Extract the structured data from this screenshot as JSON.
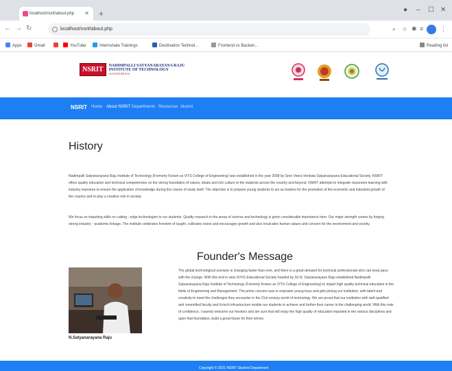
{
  "browser": {
    "tab_title": "localhost/nsrit/about.php",
    "url": "localhost/nsrit/about.php",
    "bookmarks": [
      {
        "label": "Apps",
        "color": "#4285f4"
      },
      {
        "label": "Gmail",
        "color": "#ea4335"
      },
      {
        "label": "",
        "color": "#ea4335"
      },
      {
        "label": "YouTube",
        "color": "#ff0000"
      },
      {
        "label": "Internshala Trainings",
        "color": "#1ea0e3"
      },
      {
        "label": "Destination Technol...",
        "color": "#2d5fa8"
      },
      {
        "label": "Frontend vs Backen...",
        "color": "#777777"
      }
    ],
    "reading_list": "Reading list"
  },
  "header": {
    "logo_badge": "NSRIT",
    "logo_line1": "NADIMPALLI SATYANARAYANA RAJU",
    "logo_line2": "INSTITUTE OF TECHNOLOGY",
    "logo_line3": "(AUTONOMOUS)",
    "emblems": [
      {
        "caption": "AICTE",
        "color": "#d0305a"
      },
      {
        "caption": "JNTUK",
        "color": "#e0a020"
      },
      {
        "caption": "NAAC",
        "color": "#4a9a3a"
      },
      {
        "caption": "ISO",
        "color": "#2a6fb0"
      }
    ]
  },
  "nav": {
    "brand": "NSRIT",
    "links": [
      "Home",
      "About NSRIT",
      "Departments",
      "Resources",
      "Alumni"
    ],
    "active_index": 1
  },
  "history": {
    "title": "History",
    "paragraph1": "Nadimpalli Satyanarayana Raju Institute of Technology (Formerly Known as VITS College of Engineering) was established in the year 2008 by Sree Veera Venkata Satyanarayana Educational Society. NSRIT offers quality education and technical competencies on the strong foundation of values, ideals and rich culture to the students across the country and beyond. NSRIT attempts to integrate classroom learning with industry exposure to ensure the application of knowledge during the course of study itself. The objective is to prepare young students to act as leaders for the promotion of the economic and industrial growth of the country and to play a creative role in society.",
    "paragraph2": "We focus on imparting skills on cutting - edge technologies to our students. Quality research in the areas of science and technology is given considerable importance here. Our major strength comes by forging strong industry - academic linkage. The institute celebrates freedom of taught, cultivates vision and encourages growth and also inculcates human values and concern for the environment and society."
  },
  "founder": {
    "title": "Founder's Message",
    "name": "N.Satyanarayana Raju",
    "message": "The global technological scenario is changing faster than ever, and there is a great demand for technical professionals who can keep pace with the change. With this end in view SVVS Educational Society headed by Sri N. Satyanarayana Raju established Nadimpalli Satyanarayana Raju Institute of Technology (Formerly Known as VITS College of Engineering) to impart high quality technical education in the fields of Engineering and Management. The prime concern was to empower young boys and girls joining our institution, with talent and creativity to meet the challenges they encounter in the 21st century world of technology. We are proud that our institution with well-qualified and committed faculty and hi-tech infrastructure enable our students to achieve and further their career in the challenging world. With this note of confidence, I warmly welcome our freshers and am sure that will enjoy the high quality of education imparted in the various disciplines and upon that foundation, build a great future for their selves."
  },
  "footer": {
    "text": "Copyright © 2021 NSRIT Student Department"
  },
  "colors": {
    "primary_blue": "#1e7ff2",
    "logo_red": "#c8102e"
  }
}
